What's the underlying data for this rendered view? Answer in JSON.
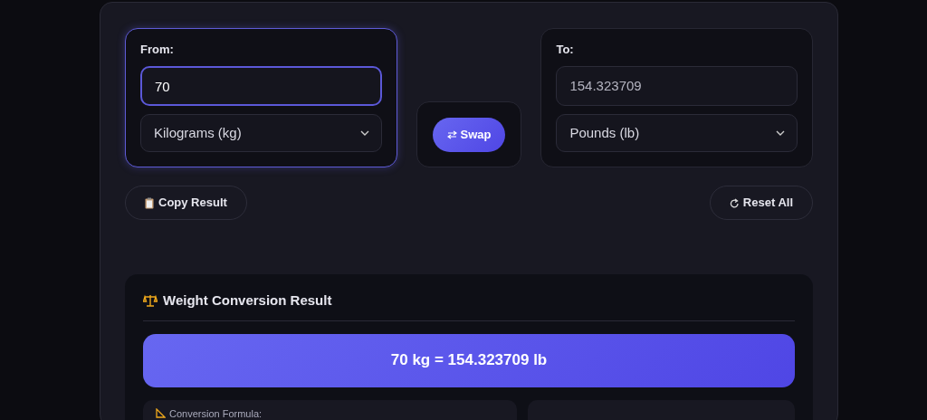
{
  "from": {
    "label": "From:",
    "value": "70",
    "unit": "Kilograms (kg)"
  },
  "swap": {
    "label": "Swap"
  },
  "to": {
    "label": "To:",
    "value": "154.323709",
    "unit": "Pounds (lb)"
  },
  "actions": [
    {
      "kind": "copy",
      "label": "Copy Result"
    },
    {
      "kind": "reset",
      "label": "Reset All"
    }
  ],
  "result": {
    "title": "Weight Conversion Result",
    "summary": "70 kg = 154.323709 lb",
    "formula_label": "Conversion Formula:"
  }
}
